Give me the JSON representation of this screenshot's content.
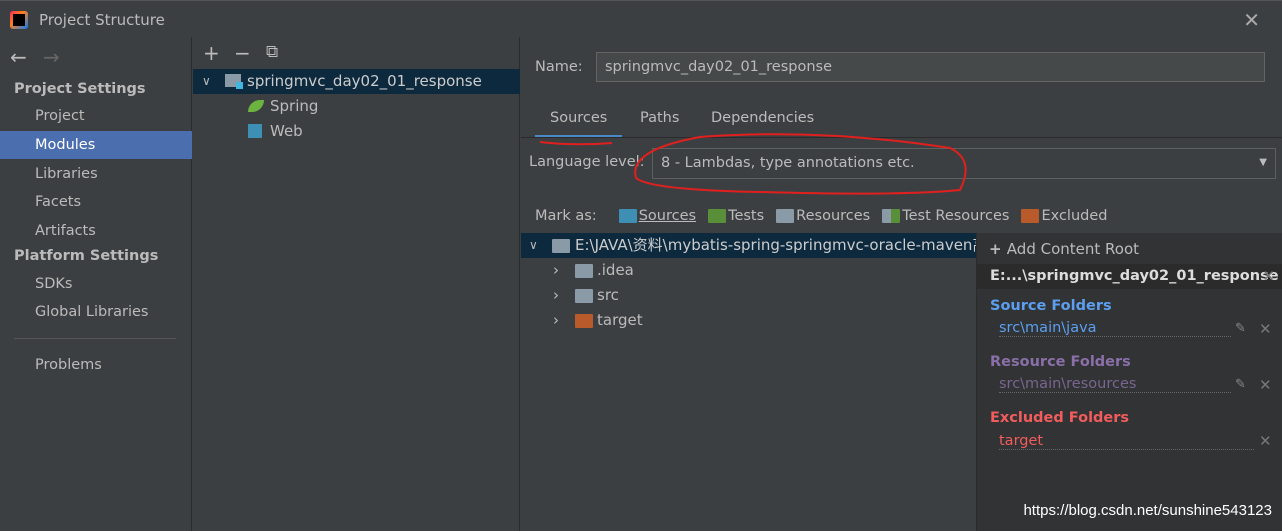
{
  "window": {
    "title": "Project Structure",
    "close": "✕"
  },
  "sidebar": {
    "back": "←",
    "forward": "→",
    "project_settings": "Project Settings",
    "items": [
      "Project",
      "Modules",
      "Libraries",
      "Facets",
      "Artifacts"
    ],
    "platform_settings": "Platform Settings",
    "platform_items": [
      "SDKs",
      "Global Libraries"
    ],
    "problems": "Problems",
    "selected": "Modules"
  },
  "modules": {
    "toolbar": {
      "add": "+",
      "remove": "−",
      "copy": "⧉"
    },
    "root": "springmvc_day02_01_response",
    "children": [
      "Spring",
      "Web"
    ]
  },
  "module": {
    "name_label": "Name:",
    "name_value": "springmvc_day02_01_response",
    "tabs": [
      "Sources",
      "Paths",
      "Dependencies"
    ],
    "active_tab": "Sources",
    "language_label": "Language level:",
    "language_value": "8 - Lambdas, type annotations etc.",
    "mark_as": {
      "label": "Mark as:",
      "items": [
        "Sources",
        "Tests",
        "Resources",
        "Test Resources",
        "Excluded"
      ]
    },
    "tree": {
      "root": "E:\\JAVA\\资料\\mybatis-spring-springmvc-oracle-maven高",
      "children": [
        ".idea",
        "src",
        "target"
      ]
    },
    "content_root": {
      "add": "Add Content Root",
      "path": "E:...\\springmvc_day02_01_response",
      "source_header": "Source Folders",
      "source": "src\\main\\java",
      "resource_header": "Resource Folders",
      "resource": "src\\main\\resources",
      "excluded_header": "Excluded Folders",
      "excluded": "target"
    }
  },
  "colors": {
    "sources": "#3d8fb4",
    "tests": "#5a8f3a",
    "excluded": "#b85a2a",
    "source_header": "#5c9ff0",
    "resource_header": "#8b6fa8",
    "excluded_header": "#f25c5c",
    "annotation": "#e0201e",
    "selection": "#4b6eaf"
  },
  "watermark": "https://blog.csdn.net/sunshine543123"
}
